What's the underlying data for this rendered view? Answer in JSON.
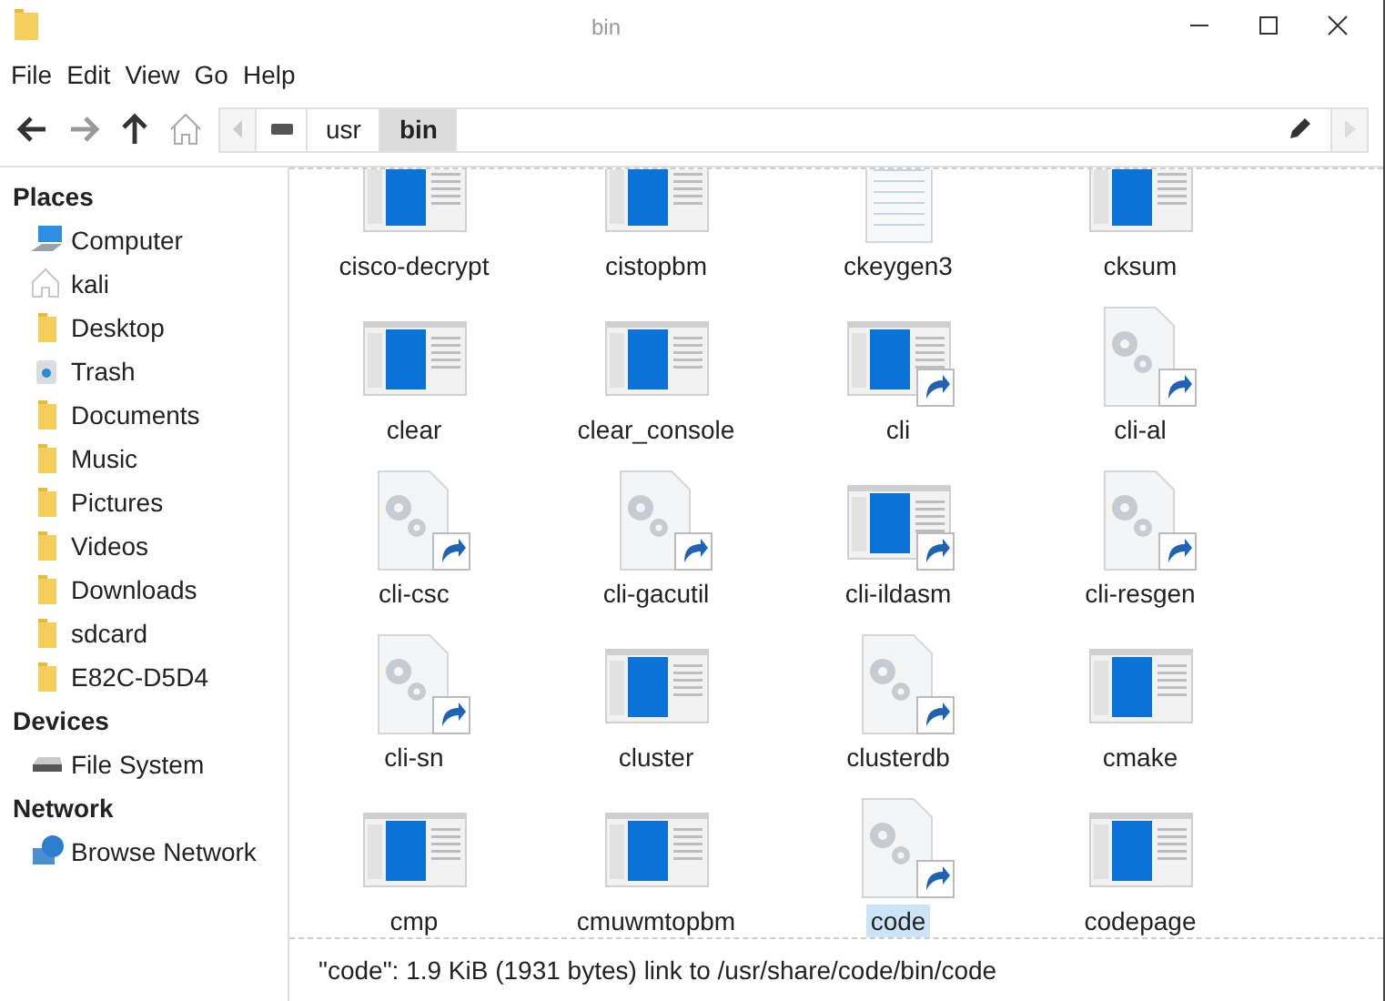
{
  "window": {
    "title": "bin"
  },
  "menu": [
    "File",
    "Edit",
    "View",
    "Go",
    "Help"
  ],
  "path": [
    {
      "label": "usr",
      "selected": false
    },
    {
      "label": "bin",
      "selected": true
    }
  ],
  "sidebar": [
    {
      "heading": "Places",
      "items": [
        {
          "label": "Computer",
          "kind": "computer"
        },
        {
          "label": "kali",
          "kind": "home"
        },
        {
          "label": "Desktop",
          "kind": "folder"
        },
        {
          "label": "Trash",
          "kind": "trash"
        },
        {
          "label": "Documents",
          "kind": "folder"
        },
        {
          "label": "Music",
          "kind": "folder"
        },
        {
          "label": "Pictures",
          "kind": "folder"
        },
        {
          "label": "Videos",
          "kind": "folder"
        },
        {
          "label": "Downloads",
          "kind": "folder"
        },
        {
          "label": "sdcard",
          "kind": "folder"
        },
        {
          "label": "E82C-D5D4",
          "kind": "folder"
        }
      ]
    },
    {
      "heading": "Devices",
      "items": [
        {
          "label": "File System",
          "kind": "drive"
        }
      ]
    },
    {
      "heading": "Network",
      "items": [
        {
          "label": "Browse Network",
          "kind": "network"
        }
      ]
    }
  ],
  "files": [
    {
      "name": "cisco-decrypt",
      "kind": "app",
      "link": false,
      "selected": false
    },
    {
      "name": "cistopbm",
      "kind": "app",
      "link": false,
      "selected": false
    },
    {
      "name": "ckeygen3",
      "kind": "text",
      "link": false,
      "selected": false
    },
    {
      "name": "cksum",
      "kind": "app",
      "link": false,
      "selected": false
    },
    {
      "name": "clear",
      "kind": "app",
      "link": false,
      "selected": false
    },
    {
      "name": "clear_console",
      "kind": "app",
      "link": false,
      "selected": false
    },
    {
      "name": "cli",
      "kind": "app",
      "link": true,
      "selected": false
    },
    {
      "name": "cli-al",
      "kind": "exec",
      "link": true,
      "selected": false
    },
    {
      "name": "cli-csc",
      "kind": "exec",
      "link": true,
      "selected": false
    },
    {
      "name": "cli-gacutil",
      "kind": "exec",
      "link": true,
      "selected": false
    },
    {
      "name": "cli-ildasm",
      "kind": "app",
      "link": true,
      "selected": false
    },
    {
      "name": "cli-resgen",
      "kind": "exec",
      "link": true,
      "selected": false
    },
    {
      "name": "cli-sn",
      "kind": "exec",
      "link": true,
      "selected": false
    },
    {
      "name": "cluster",
      "kind": "app",
      "link": false,
      "selected": false
    },
    {
      "name": "clusterdb",
      "kind": "exec",
      "link": true,
      "selected": false
    },
    {
      "name": "cmake",
      "kind": "app",
      "link": false,
      "selected": false
    },
    {
      "name": "cmp",
      "kind": "app",
      "link": false,
      "selected": false
    },
    {
      "name": "cmuwmtopbm",
      "kind": "app",
      "link": false,
      "selected": false
    },
    {
      "name": "code",
      "kind": "exec",
      "link": true,
      "selected": true
    },
    {
      "name": "codepage",
      "kind": "app",
      "link": false,
      "selected": false
    }
  ],
  "status_bar": "\"code\": 1.9 KiB (1931 bytes) link to /usr/share/code/bin/code"
}
